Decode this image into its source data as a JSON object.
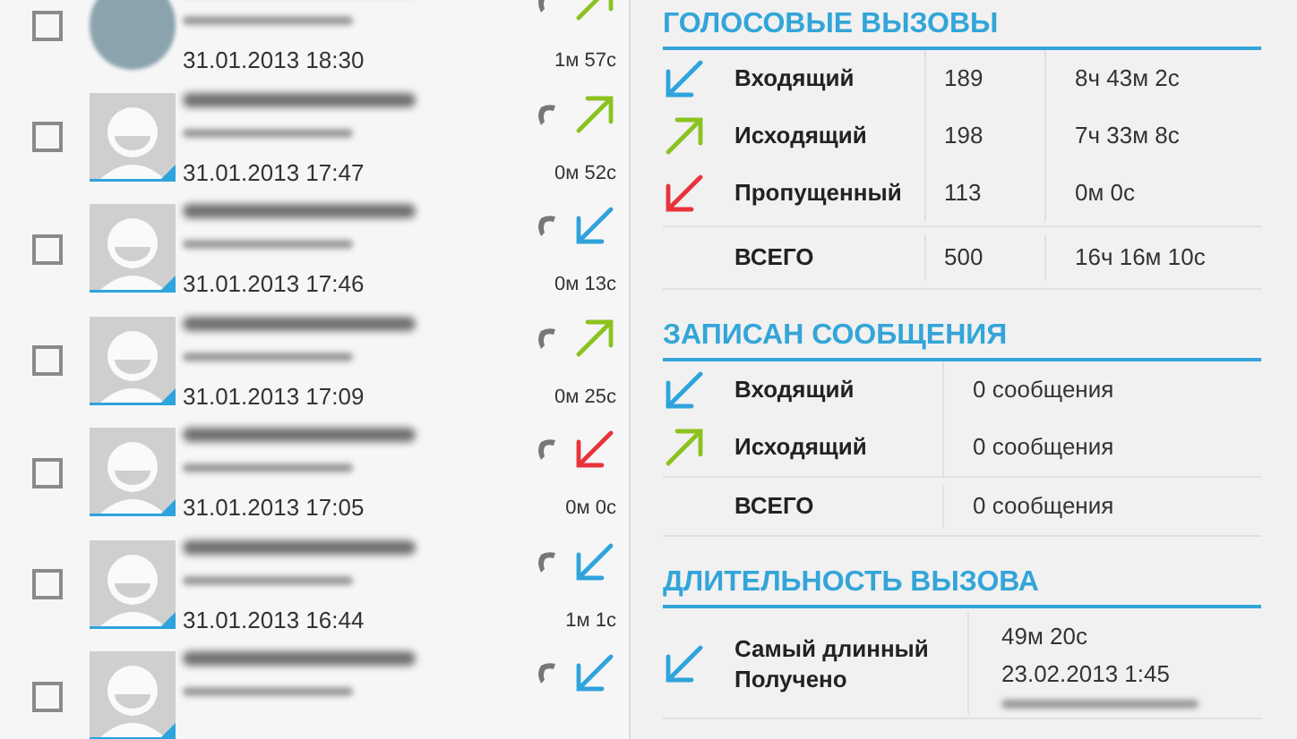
{
  "call_log": [
    {
      "photo": true,
      "checked": false,
      "kind": "outgoing",
      "date": "31.01.2013 18:30",
      "duration": "1м 57с"
    },
    {
      "photo": false,
      "checked": false,
      "kind": "outgoing",
      "date": "31.01.2013 17:47",
      "duration": "0м 52с"
    },
    {
      "photo": false,
      "checked": false,
      "kind": "incoming",
      "date": "31.01.2013 17:46",
      "duration": "0м 13с"
    },
    {
      "photo": false,
      "checked": false,
      "kind": "outgoing",
      "date": "31.01.2013 17:09",
      "duration": "0м 25с"
    },
    {
      "photo": false,
      "checked": false,
      "kind": "missed",
      "date": "31.01.2013 17:05",
      "duration": "0м 0с"
    },
    {
      "photo": false,
      "checked": false,
      "kind": "incoming",
      "date": "31.01.2013 16:44",
      "duration": "1м 1с"
    },
    {
      "photo": false,
      "checked": false,
      "kind": "incoming"
    }
  ],
  "voice_calls": {
    "title": "ГОЛОСОВЫЕ ВЫЗОВЫ",
    "rows": [
      {
        "kind": "incoming",
        "label": "Входящий",
        "count": "189",
        "duration": "8ч 43м 2с"
      },
      {
        "kind": "outgoing",
        "label": "Исходящий",
        "count": "198",
        "duration": "7ч 33м 8с"
      },
      {
        "kind": "missed",
        "label": "Пропущенный",
        "count": "113",
        "duration": "0м 0с"
      }
    ],
    "total": {
      "label": "ВСЕГО",
      "count": "500",
      "duration": "16ч 16м 10с"
    }
  },
  "messages": {
    "title": "ЗАПИСАН СООБЩЕНИЯ",
    "rows": [
      {
        "kind": "incoming",
        "label": "Входящий",
        "value": "0 сообщения"
      },
      {
        "kind": "outgoing",
        "label": "Исходящий",
        "value": "0 сообщения"
      }
    ],
    "total": {
      "label": "ВСЕГО",
      "value": "0 сообщения"
    }
  },
  "call_duration": {
    "title": "ДЛИТЕЛЬНОСТЬ ВЫЗОВА",
    "kind": "incoming",
    "label": "Самый длинный Получено",
    "duration": "49м 20с",
    "date": "23.02.2013 1:45"
  }
}
